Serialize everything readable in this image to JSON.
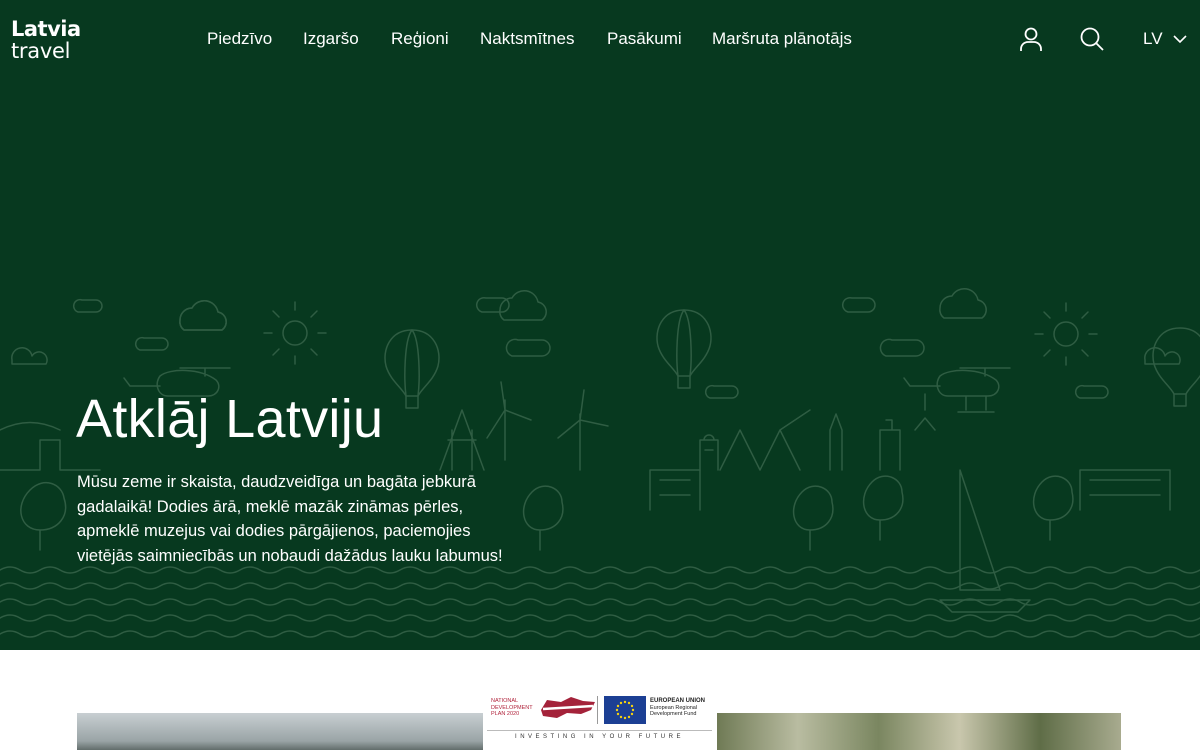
{
  "brand": {
    "line1": "Latvia",
    "line2": "travel"
  },
  "nav": {
    "items": [
      "Piedzīvo",
      "Izgaršo",
      "Reģioni",
      "Naktsmītnes",
      "Pasākumi",
      "Maršruta plānotājs"
    ]
  },
  "utilities": {
    "user_icon": "user-icon",
    "search_icon": "search-icon",
    "language": "LV",
    "language_icon": "chevron-down-icon"
  },
  "hero": {
    "title": "Atklāj Latviju",
    "text": "Mūsu zeme ir skaista, daudzveidīga un bagāta jebkurā gadalaikā! Dodies ārā, meklē mazāk zināmas pērles, apmeklē muzejus vai dodies pārgājienos, paciemojies vietējās saimniecībās un nobaudi dažādus lauku labumus!",
    "background_color": "#07391f"
  },
  "eu_banner": {
    "ndp_lines": [
      "NATIONAL",
      "DEVELOPMENT",
      "PLAN 2020"
    ],
    "eu_title": "EUROPEAN UNION",
    "eu_lines": [
      "European Regional",
      "Development Fund"
    ],
    "slogan": "INVESTING IN YOUR FUTURE"
  }
}
